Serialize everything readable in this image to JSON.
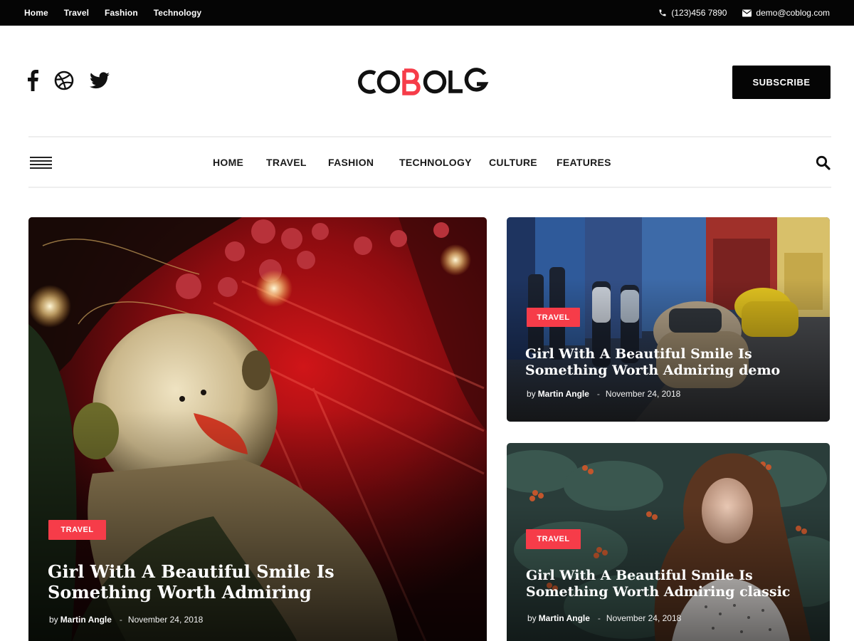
{
  "topbar": {
    "links": [
      "Home",
      "Travel",
      "Fashion",
      "Technology"
    ],
    "phone": "(123)456 7890",
    "email": "demo@coblog.com"
  },
  "header": {
    "logo": "COBOLG",
    "social_icons": [
      "facebook-icon",
      "dribbble-icon",
      "twitter-icon"
    ],
    "subscribe_label": "SUBSCRIBE"
  },
  "nav": {
    "items": [
      "HOME",
      "TRAVEL",
      "FASHION",
      "TECHNOLOGY",
      "CULTURE",
      "FEATURES"
    ]
  },
  "posts": [
    {
      "category": "TRAVEL",
      "title": "Girl With A Beautiful Smile Is Something Worth Admiring",
      "by": "by",
      "author": "Martin Angle",
      "separator": "-",
      "date": "November 24, 2018"
    },
    {
      "category": "TRAVEL",
      "title": "Girl With A Beautiful Smile Is Something Worth Admiring demo",
      "by": "by",
      "author": "Martin Angle",
      "separator": "-",
      "date": "November 24, 2018"
    },
    {
      "category": "TRAVEL",
      "title": "Girl With A Beautiful Smile Is Something Worth Admiring classic",
      "by": "by",
      "author": "Martin Angle",
      "separator": "-",
      "date": "November 24, 2018"
    }
  ],
  "colors": {
    "accent": "#f63c49",
    "topbar": "#050505",
    "text": "#1a1a1a"
  }
}
